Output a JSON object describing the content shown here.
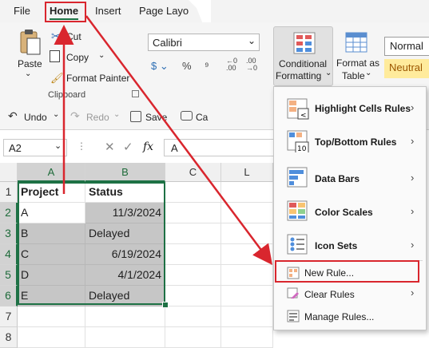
{
  "menubar": {
    "tabs": [
      "File",
      "Home",
      "Insert",
      "Page Layo"
    ]
  },
  "ribbon": {
    "clipboard": {
      "paste_label": "Paste",
      "cut_label": "Cut",
      "copy_label": "Copy",
      "format_painter_label": "Format Painter",
      "group_label": "Clipboard"
    },
    "font": {
      "font_name": "Calibri"
    },
    "conditional_formatting": {
      "label_line1": "Conditional",
      "label_line2": "Formatting"
    },
    "format_as_table": {
      "label_line1": "Format as",
      "label_line2": "Table"
    },
    "styles": {
      "normal": "Normal",
      "neutral": "Neutral"
    }
  },
  "qat": {
    "undo_label": "Undo",
    "redo_label": "Redo",
    "save_label": "Save",
    "camera_label": "Ca"
  },
  "formula_bar": {
    "name_box": "A2",
    "fx": "fx",
    "content": "A"
  },
  "grid": {
    "col_headers": [
      "A",
      "B",
      "C",
      "L"
    ],
    "row_headers": [
      "1",
      "2",
      "3",
      "4",
      "5",
      "6",
      "7",
      "8"
    ],
    "rows": [
      [
        "Project",
        "Status"
      ],
      [
        "A",
        "11/3/2024"
      ],
      [
        "B",
        "Delayed"
      ],
      [
        "C",
        "6/19/2024"
      ],
      [
        "D",
        "4/1/2024"
      ],
      [
        "E",
        "Delayed"
      ]
    ]
  },
  "cf_menu": {
    "items": [
      {
        "label": "Highlight Cells Rules",
        "icon": "highlight-cells-icon"
      },
      {
        "label": "Top/Bottom Rules",
        "icon": "top-bottom-icon"
      },
      {
        "label": "Data Bars",
        "icon": "data-bars-icon"
      },
      {
        "label": "Color Scales",
        "icon": "color-scales-icon"
      },
      {
        "label": "Icon Sets",
        "icon": "icon-sets-icon"
      },
      {
        "label": "New Rule...",
        "icon": "new-rule-icon"
      },
      {
        "label": "Clear Rules",
        "icon": "clear-rules-icon"
      },
      {
        "label": "Manage Rules...",
        "icon": "manage-rules-icon"
      }
    ]
  },
  "colors": {
    "accent": "#1e7145",
    "annotation_red": "#d9262e",
    "selection_shade": "#c6c6c6",
    "neutral_style": "#ffeb9c"
  }
}
